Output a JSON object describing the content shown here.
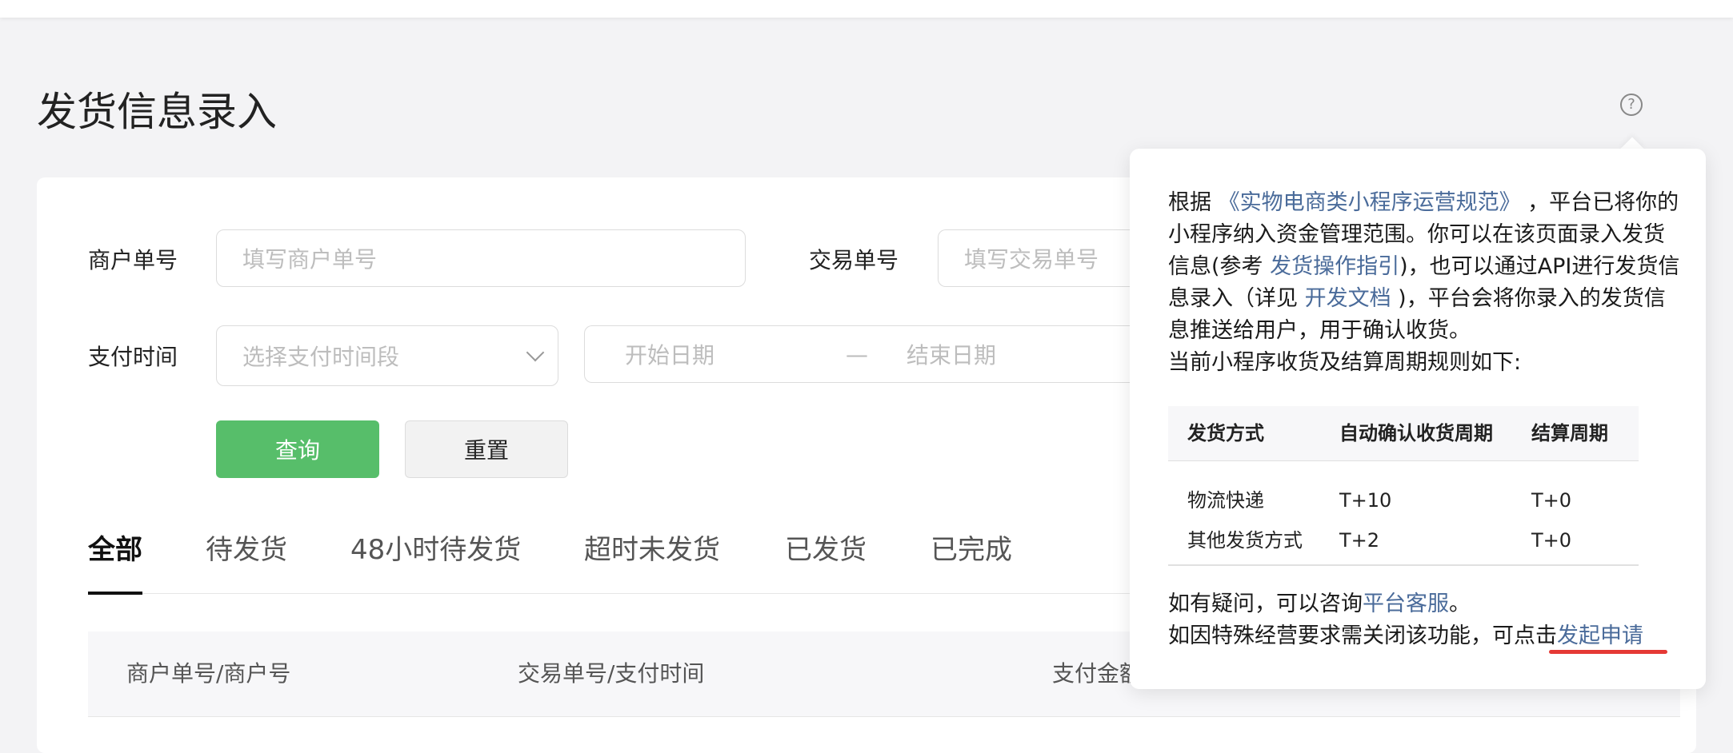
{
  "page": {
    "title": "发货信息录入"
  },
  "help_icon": {
    "glyph": "?"
  },
  "filters": {
    "merchant_no": {
      "label": "商户单号",
      "placeholder": "填写商户单号"
    },
    "trade_no": {
      "label": "交易单号",
      "placeholder": "填写交易单号"
    },
    "pay_time": {
      "label": "支付时间",
      "select_placeholder": "选择支付时间段",
      "start_placeholder": "开始日期",
      "separator": "—",
      "end_placeholder": "结束日期"
    },
    "query_button": "查询",
    "reset_button": "重置"
  },
  "tabs": [
    "全部",
    "待发货",
    "48小时待发货",
    "超时未发货",
    "已发货",
    "已完成"
  ],
  "active_tab": "全部",
  "table": {
    "columns": [
      "商户单号/商户号",
      "交易单号/支付时间",
      "支付金额"
    ]
  },
  "popover": {
    "p1_a": "根据 ",
    "p1_link": "《实物电商类小程序运营规范》",
    "p1_b": " ，平台已将你的小程序纳入资金管理范围。你可以在该页面录入发货信息(参考 ",
    "p1_link2": "发货操作指引",
    "p1_c": ")，也可以通过API进行发货信息录入（详见 ",
    "p1_link3": "开发文档",
    "p1_d": " )，平台会将你录入的发货信息推送给用户，用于确认收货。",
    "p2": "当前小程序收货及结算周期规则如下:",
    "rules_table": {
      "headers": [
        "发货方式",
        "自动确认收货周期",
        "结算周期"
      ],
      "rows": [
        [
          "物流快递",
          "T+10",
          "T+0"
        ],
        [
          "其他发货方式",
          "T+2",
          "T+0"
        ]
      ]
    },
    "footer1_a": "如有疑问，可以咨询",
    "footer1_link": "平台客服",
    "footer1_b": "。",
    "footer2_a": "如因特殊经营要求需关闭该功能，可点击",
    "footer2_link": "发起申请"
  },
  "colors": {
    "primary_green": "#57be6a",
    "link_blue": "#4a6b9a",
    "highlight_red": "#e53935"
  }
}
